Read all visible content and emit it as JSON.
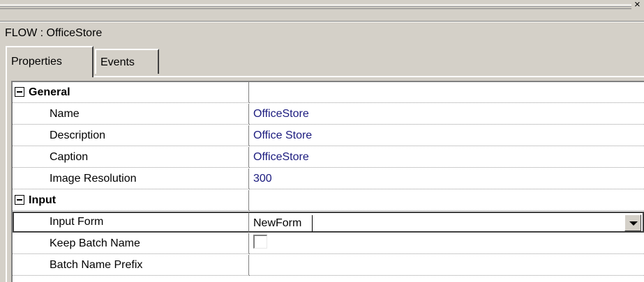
{
  "window": {
    "close_glyph": "×",
    "title": "FLOW : OfficeStore"
  },
  "tabs": [
    {
      "label": "Properties",
      "active": true
    },
    {
      "label": "Events",
      "active": false
    }
  ],
  "grid": {
    "categories": [
      {
        "label": "General",
        "expanded": true,
        "properties": [
          {
            "name": "Name",
            "value": "OfficeStore"
          },
          {
            "name": "Description",
            "value": "Office Store"
          },
          {
            "name": "Caption",
            "value": "OfficeStore"
          },
          {
            "name": "Image Resolution",
            "value": "300"
          }
        ]
      },
      {
        "label": "Input",
        "expanded": true,
        "properties": [
          {
            "name": "Input Form",
            "value": "NewForm",
            "editor": "dropdown",
            "selected": true
          },
          {
            "name": "Keep Batch Name",
            "value": false,
            "editor": "checkbox"
          },
          {
            "name": "Batch Name Prefix",
            "value": ""
          }
        ]
      }
    ]
  },
  "colors": {
    "chrome": "#d4d0c8",
    "value_text": "#1a1a7e"
  }
}
